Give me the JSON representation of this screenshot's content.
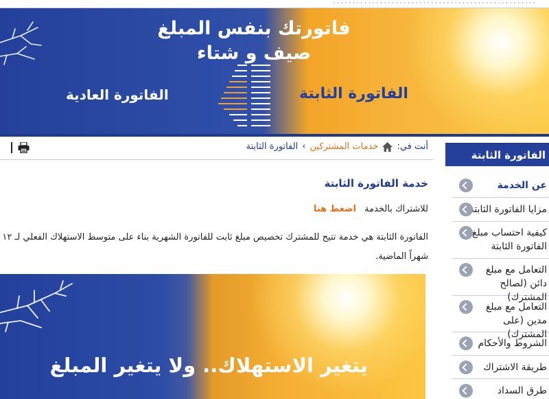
{
  "banner": {
    "line1": "فاتورتك بنفس المبلغ",
    "line2": "صيف و شتاء",
    "fixed_bill": "الفاتورة الثابتة",
    "normal_bill": "الفاتورة العادية"
  },
  "breadcrumb": {
    "prefix": "أنت في:",
    "subscriber_services": "خدمات المشتركين",
    "separator": "›",
    "current": "الفاتورة الثابتة"
  },
  "main": {
    "title": "خدمة الفاتورة الثابتة",
    "subscribe_label": "للاشتراك بالخدمة",
    "subscribe_link": "اضغط هنا",
    "paragraph": "الفاتورة الثابتة هي خدمة تتيح للمشترك تخصيص مبلغ ثابت للفاتورة الشهرية بناء على متوسط الاستهلاك الفعلي لـ ١٢ شهراً الماضية."
  },
  "promo": {
    "text": "يتغير الاستهلاك.. ولا يتغير المبلغ"
  },
  "sidebar": {
    "header": "الفاتورة الثابتة",
    "items": [
      {
        "label": "عن الخدمة"
      },
      {
        "label": "مزايا الفاتورة الثابتة"
      },
      {
        "label": "كيفية احتساب مبلغ الفاتورة الثابتة"
      },
      {
        "label": "التعامل مع مبلغ دائن (لصالح المشترك)"
      },
      {
        "label": "التعامل مع مبلغ مدين (على المشترك)"
      },
      {
        "label": "الشروط والأحكام"
      },
      {
        "label": "طريقة الاشتراك"
      },
      {
        "label": "طرق السداد"
      }
    ]
  },
  "colors": {
    "brand_blue": "#24409a",
    "accent_orange": "#e0701a",
    "sun_yellow": "#f7b43a"
  }
}
